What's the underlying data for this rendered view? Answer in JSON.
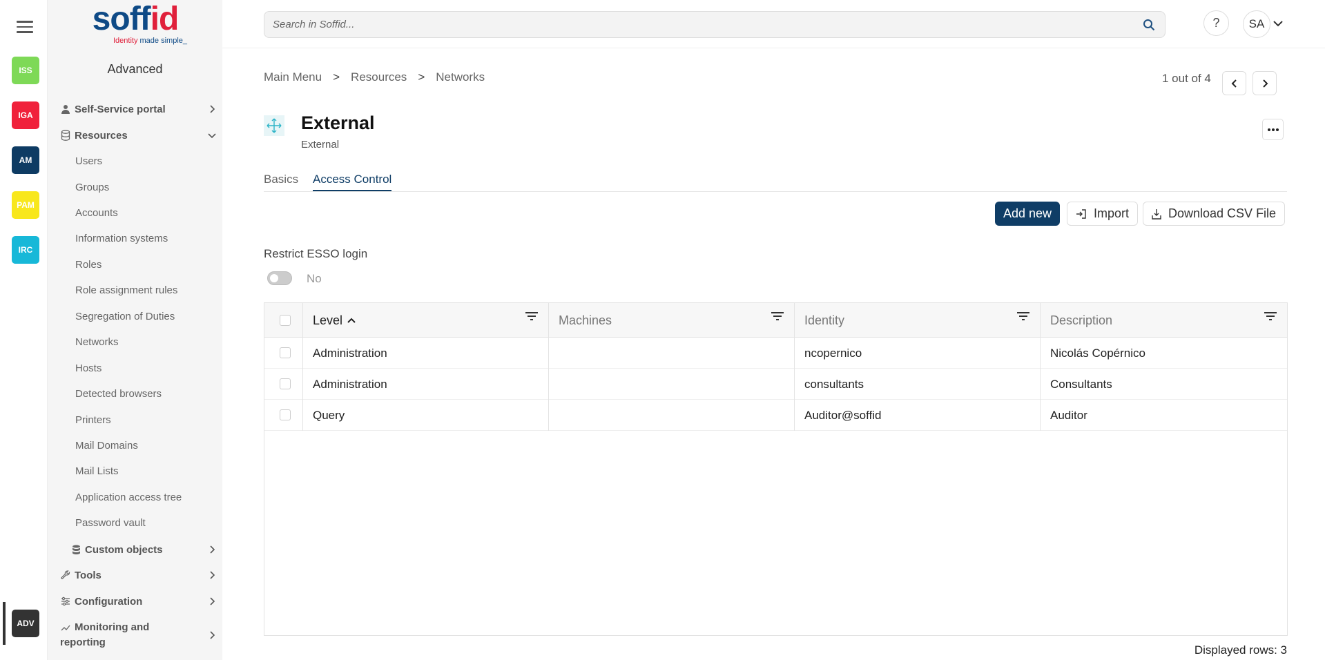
{
  "rail": {
    "items": [
      {
        "label": "ISS",
        "color": "#7ed957"
      },
      {
        "label": "IGA",
        "color": "#f0213b"
      },
      {
        "label": "AM",
        "color": "#0e3b63"
      },
      {
        "label": "PAM",
        "color": "#f8e71c"
      },
      {
        "label": "IRC",
        "color": "#17b8d8"
      },
      {
        "label": "ADV",
        "color": "#333333"
      }
    ]
  },
  "logo": {
    "main_a": "soff",
    "main_b": "id",
    "tag_a": "Identity ",
    "tag_b": "made simple_"
  },
  "sidebar": {
    "title": "Advanced",
    "self_service": "Self-Service portal",
    "resources": "Resources",
    "resource_items": [
      "Users",
      "Groups",
      "Accounts",
      "Information systems",
      "Roles",
      "Role assignment rules",
      "Segregation of Duties",
      "Networks",
      "Hosts",
      "Detected browsers",
      "Printers",
      "Mail Domains",
      "Mail Lists",
      "Application access tree",
      "Password vault"
    ],
    "custom_objects": "Custom objects",
    "tools": "Tools",
    "configuration": "Configuration",
    "monitoring_1": "Monitoring and",
    "monitoring_2": "reporting"
  },
  "search": {
    "placeholder": "Search in Soffid..."
  },
  "header": {
    "help": "?",
    "avatar": "SA"
  },
  "breadcrumb": {
    "items": [
      "Main Menu",
      "Resources",
      "Networks"
    ],
    "sep": ">"
  },
  "pager": {
    "text": "1 out of 4"
  },
  "page": {
    "title": "External",
    "subtitle": "External"
  },
  "tabs": {
    "basics": "Basics",
    "access_control": "Access Control"
  },
  "actions": {
    "add_new": "Add new",
    "import": "Import",
    "download": "Download CSV File"
  },
  "esso": {
    "label": "Restrict ESSO login",
    "value": "No"
  },
  "table": {
    "columns": [
      "Level",
      "Machines",
      "Identity",
      "Description"
    ],
    "rows": [
      {
        "level": "Administration",
        "machines": "",
        "identity": "ncopernico",
        "description": "Nicolás Copérnico"
      },
      {
        "level": "Administration",
        "machines": "",
        "identity": "consultants",
        "description": "Consultants"
      },
      {
        "level": "Query",
        "machines": "",
        "identity": "Auditor@soffid",
        "description": "Auditor"
      }
    ],
    "displayed_rows": "Displayed rows: 3"
  }
}
